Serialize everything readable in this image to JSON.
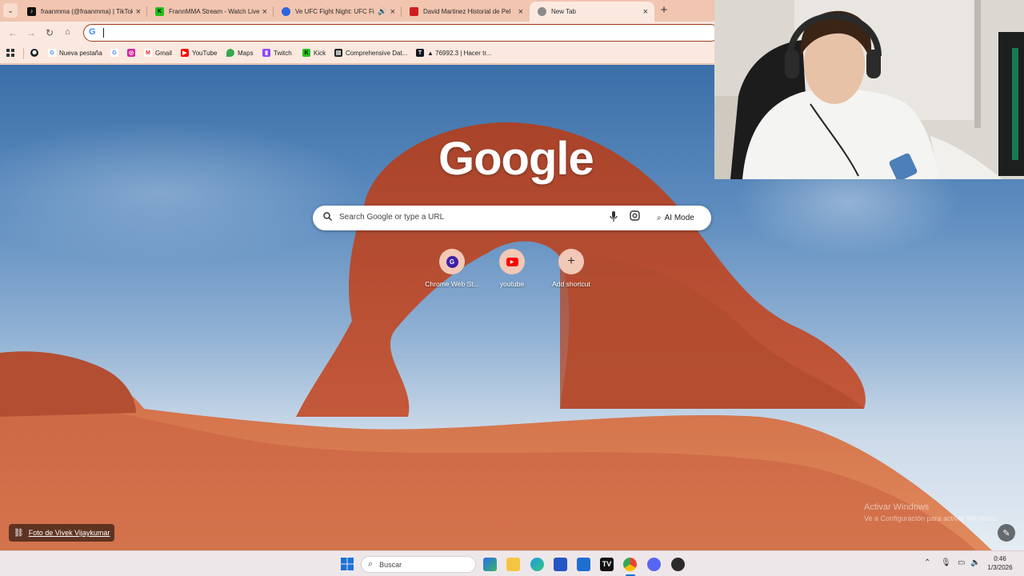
{
  "tabs": [
    {
      "title": "fraanmma (@fraanmma) | TikTok",
      "favicon": "tiktok-icon",
      "color": "#111111",
      "active": false
    },
    {
      "title": "FrannMMA Stream - Watch Live",
      "favicon": "kick-icon",
      "color": "#22c21a",
      "active": false
    },
    {
      "title": "Ve UFC Fight Night: UFC Fight",
      "favicon": "paramount-icon",
      "color": "#2f63e0",
      "active": false,
      "audio": true
    },
    {
      "title": "David Martinez Historial de Pel",
      "favicon": "sherdog-icon",
      "color": "#cc1f1f",
      "active": false
    },
    {
      "title": "New Tab",
      "favicon": "chrome-icon",
      "color": "#8a8a8a",
      "active": true
    }
  ],
  "omnibox": {
    "value": ""
  },
  "bookmarks": [
    {
      "label": "",
      "icon": "chatgpt-icon",
      "color": "#1f1f1f"
    },
    {
      "label": "Nueva pestaña",
      "icon": "google-icon",
      "color": "#4285f4"
    },
    {
      "label": "",
      "icon": "google-icon",
      "color": "#4285f4"
    },
    {
      "label": "",
      "icon": "instagram-icon",
      "color": "#d6249f"
    },
    {
      "label": "Gmail",
      "icon": "gmail-icon",
      "color": "#d93025"
    },
    {
      "label": "YouTube",
      "icon": "youtube-icon",
      "color": "#ff0000"
    },
    {
      "label": "Maps",
      "icon": "maps-icon",
      "color": "#34a853"
    },
    {
      "label": "Twitch",
      "icon": "twitch-icon",
      "color": "#9146ff"
    },
    {
      "label": "Kick",
      "icon": "kick-icon",
      "color": "#22c21a"
    },
    {
      "label": "Comprehensive Dat...",
      "icon": "doc-icon",
      "color": "#222222"
    },
    {
      "label": "▲ 76992.3 | Hacer tr...",
      "icon": "tradingview-icon",
      "color": "#131722"
    }
  ],
  "ntp": {
    "logo": "Google",
    "search_placeholder": "Search Google or type a URL",
    "ai_mode": "AI Mode",
    "shortcuts": [
      {
        "label": "Chrome Web St...",
        "icon": "chrome-web-store-icon"
      },
      {
        "label": "youtube",
        "icon": "youtube-icon"
      },
      {
        "label": "Add shortcut",
        "icon": "plus-icon"
      }
    ],
    "photo_credit": "Foto de Vivek Vijaykumar",
    "watermark_line1": "Activar Windows",
    "watermark_line2": "Ve a Configuración para activar Windows."
  },
  "taskbar": {
    "search_label": "Buscar",
    "time": "0:46",
    "date": "1/3/2026"
  }
}
